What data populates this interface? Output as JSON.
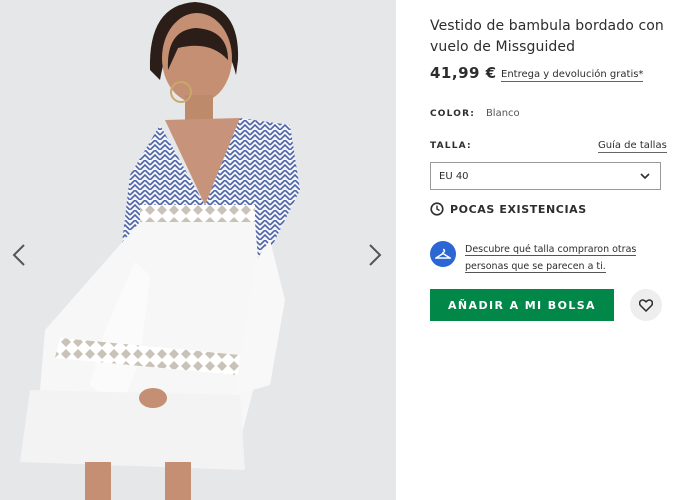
{
  "product": {
    "title": "Vestido de bambula bordado con vuelo de Missguided",
    "price": "41,99 €",
    "delivery_link": "Entrega y devolución gratis*",
    "color_label": "COLOR:",
    "color_value": "Blanco",
    "size_label": "TALLA:",
    "size_guide_link": "Guía de tallas",
    "size_selected": "EU 40",
    "stock_status": "POCAS EXISTENCIAS",
    "fit_text": "Descubre qué talla compraron otras personas que se parecen a ti.",
    "add_button": "AÑADIR A MI BOLSA"
  },
  "gallery": {
    "prev_icon": "chevron-left-icon",
    "next_icon": "chevron-right-icon",
    "background": "#e6e7e9"
  },
  "icons": {
    "clock": "clock-icon",
    "hanger": "hanger-icon",
    "heart": "heart-icon",
    "dropdown": "chevron-down-icon"
  },
  "colors": {
    "accent_green": "#018849",
    "fit_blue": "#2c66d4",
    "text": "#2d2d2d"
  }
}
